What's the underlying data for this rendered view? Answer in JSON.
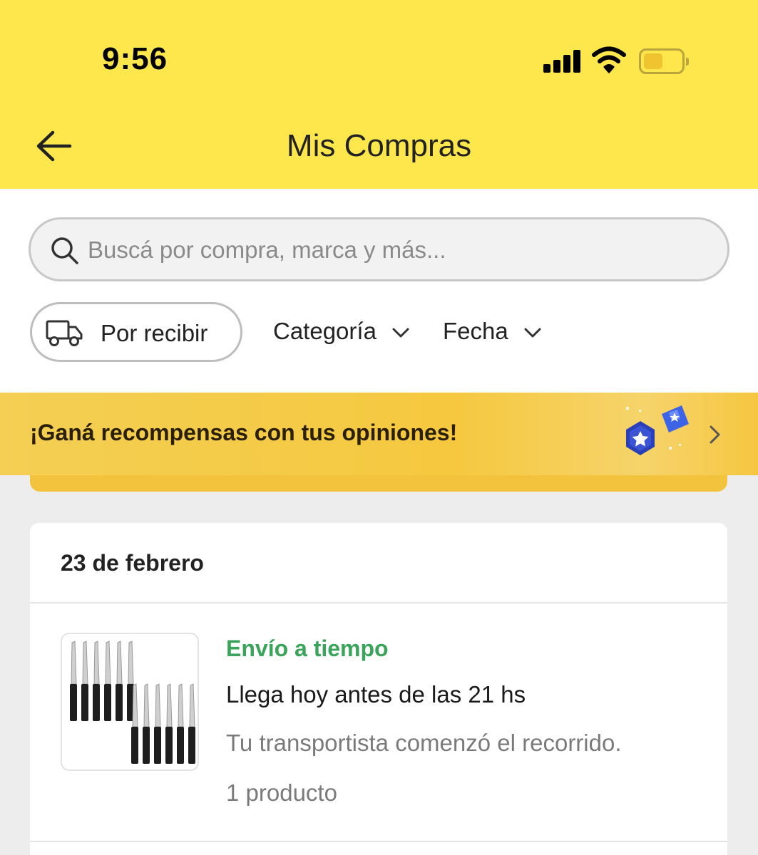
{
  "status_bar": {
    "time": "9:56",
    "icons": [
      "signal-icon",
      "wifi-icon",
      "battery-icon"
    ],
    "battery_level": 0.5
  },
  "header": {
    "title": "Mis Compras",
    "back_icon": "arrow-left-icon",
    "background": "#fde74c"
  },
  "search": {
    "placeholder": "Buscá por compra, marca y más...",
    "value": "",
    "icon": "search-icon"
  },
  "filters": {
    "chip_label": "Por recibir",
    "chip_icon": "truck-icon",
    "category_label": "Categoría",
    "date_label": "Fecha"
  },
  "reward_banner": {
    "text": "¡Ganá recompensas con tus opiniones!",
    "icon": "star-badges-icon",
    "chevron": "chevron-right-icon"
  },
  "order": {
    "date": "23 de febrero",
    "status": "Envío a tiempo",
    "status_color": "#3aa55a",
    "eta": "Llega hoy antes de las 21 hs",
    "detail": "Tu transportista comenzó el recorrido.",
    "count": "1 producto",
    "image": "knife-set-image"
  }
}
